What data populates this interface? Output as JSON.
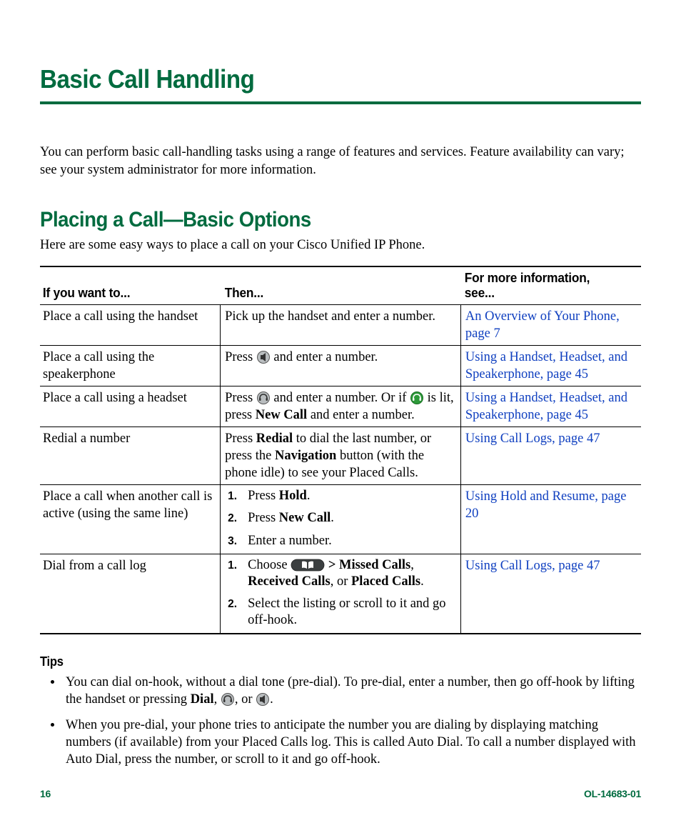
{
  "title": "Basic Call Handling",
  "intro": "You can perform basic call-handling tasks using a range of features and services. Feature availability can vary; see your system administrator for more information.",
  "section_heading": "Placing a Call—Basic Options",
  "section_lead": "Here are some easy ways to place a call on your Cisco Unified IP Phone.",
  "table": {
    "headers": {
      "col1": "If you want to...",
      "col2": "Then...",
      "col3_line1": "For more information,",
      "col3_line2": "see..."
    },
    "rows": [
      {
        "want": "Place a call using the handset",
        "then_plain": "Pick up the handset and enter a number.",
        "ref": "An Overview of Your Phone, page 7"
      },
      {
        "want": "Place a call using the speakerphone",
        "then_pre": "Press ",
        "icon1": "speaker",
        "then_post": " and enter a number.",
        "ref": "Using a Handset, Headset, and Speakerphone, page 45"
      },
      {
        "want": "Place a call using a headset",
        "then_a": "Press ",
        "icon_a": "headset",
        "then_b": " and enter a number. Or if ",
        "icon_b": "headset-lit",
        "then_c": " is lit, press ",
        "bold1": "New Call",
        "then_d": " and enter a number.",
        "ref": "Using a Handset, Headset, and Speakerphone, page 45"
      },
      {
        "want": "Redial a number",
        "then_a": "Press ",
        "bold1": "Redial",
        "then_b": " to dial the last number, or press the ",
        "bold2": "Navigation",
        "then_c": " button (with the phone idle) to see your Placed Calls.",
        "ref": "Using Call Logs, page 47"
      },
      {
        "want": "Place a call when another call is active (using the same line)",
        "steps": [
          {
            "pre": "Press ",
            "bold": "Hold",
            "post": "."
          },
          {
            "pre": "Press ",
            "bold": "New Call",
            "post": "."
          },
          {
            "pre": "Enter a number."
          }
        ],
        "ref": "Using Hold and Resume, page 20"
      },
      {
        "want": "Dial from a call log",
        "steps": [
          {
            "pre": "Choose ",
            "icon": "book",
            "post1": " ",
            "bold1": "> Missed Calls",
            "post2": ", ",
            "bold2": "Received Calls",
            "post3": ", or ",
            "bold3": "Placed Calls",
            "post4": "."
          },
          {
            "pre": "Select the listing or scroll to it and go off-hook."
          }
        ],
        "ref": "Using Call Logs, page 47"
      }
    ]
  },
  "tips_heading": "Tips",
  "tips": [
    {
      "a": "You can dial on-hook, without a dial tone (pre-dial). To pre-dial, enter a number, then go off-hook by lifting the handset or pressing ",
      "bold": "Dial",
      "b": ", ",
      "icon1": "headset",
      "c": ", or ",
      "icon2": "speaker",
      "d": "."
    },
    {
      "a": "When you pre-dial, your phone tries to anticipate the number you are dialing by displaying matching numbers (if available) from your Placed Calls log. This is called Auto Dial. To call a number displayed with Auto Dial, press the number, or scroll to it and go off-hook."
    }
  ],
  "footer": {
    "page": "16",
    "docid": "OL-14683-01"
  }
}
